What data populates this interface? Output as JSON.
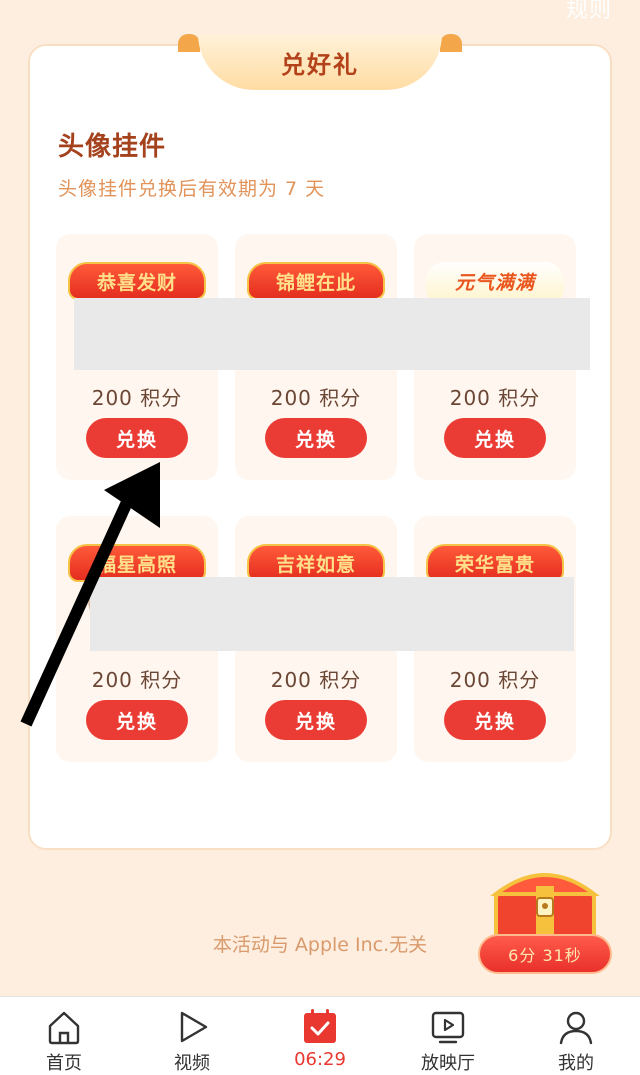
{
  "header": {
    "rules_label": "规则"
  },
  "ribbon": {
    "title": "兑好礼"
  },
  "section": {
    "title": "头像挂件",
    "subtitle": "头像挂件兑换后有效期为 7 天"
  },
  "items": [
    {
      "badge_text": "恭喜发财",
      "points_label": "200 积分",
      "button_label": "兑换"
    },
    {
      "badge_text": "锦鲤在此",
      "points_label": "200 积分",
      "button_label": "兑换"
    },
    {
      "badge_text": "元气满满",
      "points_label": "200 积分",
      "button_label": "兑换"
    },
    {
      "badge_text": "福星高照",
      "points_label": "200 积分",
      "button_label": "兑换"
    },
    {
      "badge_text": "吉祥如意",
      "points_label": "200 积分",
      "button_label": "兑换"
    },
    {
      "badge_text": "荣华富贵",
      "points_label": "200 积分",
      "button_label": "兑换"
    }
  ],
  "disclaimer": "本活动与 Apple Inc.无关",
  "treasure": {
    "timer_label": "6分 31秒"
  },
  "tabbar": {
    "items": [
      {
        "label": "首页",
        "icon": "home-icon"
      },
      {
        "label": "视频",
        "icon": "play-icon"
      },
      {
        "label": "06:29",
        "icon": "calendar-check-icon"
      },
      {
        "label": "放映厅",
        "icon": "screen-play-icon"
      },
      {
        "label": "我的",
        "icon": "user-icon"
      }
    ],
    "active_index": 2
  },
  "colors": {
    "accent_red": "#ea3c34",
    "title_brown": "#a5421e",
    "subtitle_orange": "#e1935a",
    "background_cream": "#fdeee0"
  }
}
